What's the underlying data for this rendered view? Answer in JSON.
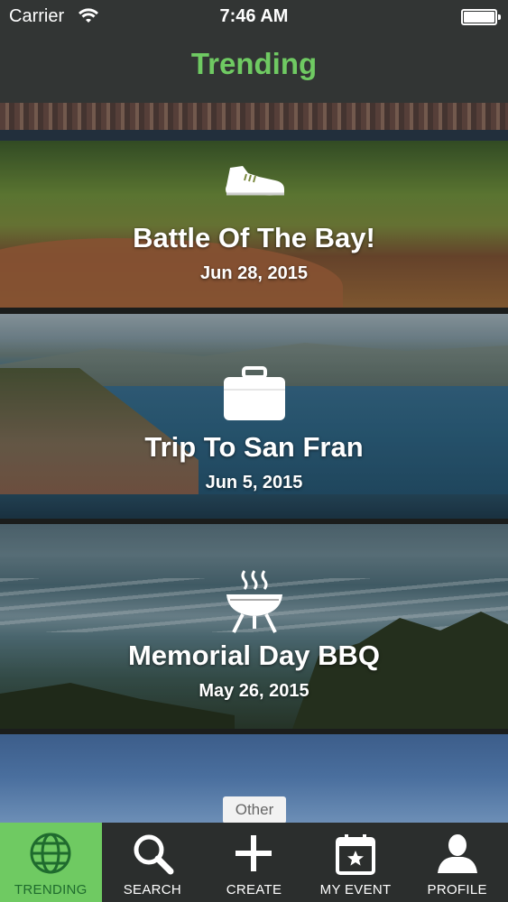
{
  "status_bar": {
    "carrier": "Carrier",
    "time": "7:46 AM"
  },
  "header": {
    "title": "Trending"
  },
  "feed": {
    "items": [
      {
        "name": "Battle Of The Bay!",
        "date": "Jun 28, 2015",
        "icon": "sneaker-icon"
      },
      {
        "name": "Trip To San Fran",
        "date": "Jun 5, 2015",
        "icon": "suitcase-icon"
      },
      {
        "name": "Memorial Day BBQ",
        "date": "May 26, 2015",
        "icon": "grill-icon"
      }
    ],
    "partial_item_tag": "Other"
  },
  "tab_bar": {
    "tabs": [
      {
        "label": "TRENDING",
        "icon": "globe-icon",
        "active": true
      },
      {
        "label": "SEARCH",
        "icon": "search-icon",
        "active": false
      },
      {
        "label": "CREATE",
        "icon": "plus-icon",
        "active": false
      },
      {
        "label": "MY EVENT",
        "icon": "calendar-icon",
        "active": false
      },
      {
        "label": "PROFILE",
        "icon": "person-icon",
        "active": false
      }
    ]
  },
  "colors": {
    "accent": "#6fca62",
    "bar_background": "#323534"
  }
}
